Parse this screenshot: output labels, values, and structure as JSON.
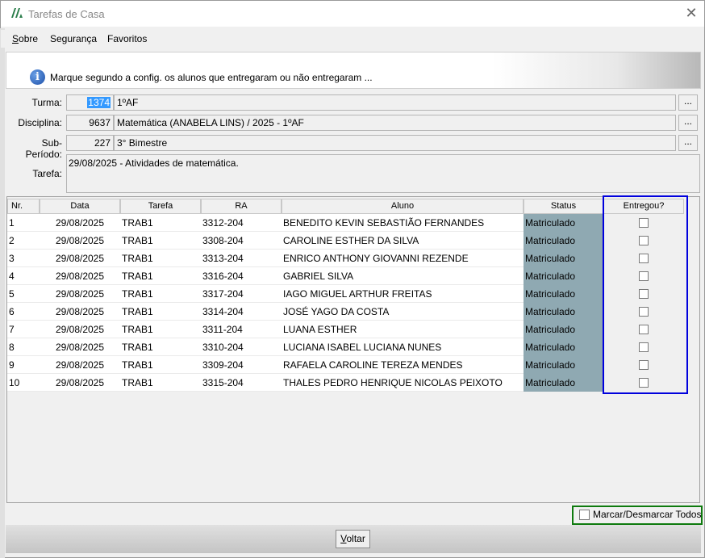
{
  "window": {
    "title": "Tarefas de Casa",
    "close_icon": "close-icon"
  },
  "menu": {
    "items": [
      "Sobre",
      "Segurança",
      "Favoritos"
    ]
  },
  "banner": {
    "icon": "info-icon",
    "text": "Marque segundo a config. os alunos que entregaram ou não entregaram ..."
  },
  "form": {
    "turma": {
      "label": "Turma:",
      "code": "1374",
      "value": "1ºAF"
    },
    "disciplina": {
      "label": "Disciplina:",
      "code": "9637",
      "value": "Matemática  (ANABELA LINS) / 2025 - 1ºAF"
    },
    "subperiodo": {
      "label": "Sub-Período:",
      "code": "227",
      "value": "3° Bimestre"
    },
    "tarefa": {
      "label": "Tarefa:",
      "value": "29/08/2025 - Atividades de matemática."
    },
    "lookup_label": "..."
  },
  "grid": {
    "columns": [
      "Nr.",
      "Data",
      "Tarefa",
      "RA",
      "Aluno",
      "Status",
      "Entregou?"
    ],
    "rows": [
      {
        "nr": "1",
        "data": "29/08/2025",
        "tarefa": "TRAB1",
        "ra": "3312-204",
        "aluno": "BENEDITO KEVIN SEBASTIÃO FERNANDES",
        "status": "Matriculado",
        "entregou": false
      },
      {
        "nr": "2",
        "data": "29/08/2025",
        "tarefa": "TRAB1",
        "ra": "3308-204",
        "aluno": "CAROLINE ESTHER DA SILVA",
        "status": "Matriculado",
        "entregou": false
      },
      {
        "nr": "3",
        "data": "29/08/2025",
        "tarefa": "TRAB1",
        "ra": "3313-204",
        "aluno": "ENRICO ANTHONY GIOVANNI REZENDE",
        "status": "Matriculado",
        "entregou": false
      },
      {
        "nr": "4",
        "data": "29/08/2025",
        "tarefa": "TRAB1",
        "ra": "3316-204",
        "aluno": "GABRIEL SILVA",
        "status": "Matriculado",
        "entregou": false
      },
      {
        "nr": "5",
        "data": "29/08/2025",
        "tarefa": "TRAB1",
        "ra": "3317-204",
        "aluno": "IAGO MIGUEL ARTHUR FREITAS",
        "status": "Matriculado",
        "entregou": false
      },
      {
        "nr": "6",
        "data": "29/08/2025",
        "tarefa": "TRAB1",
        "ra": "3314-204",
        "aluno": "JOSÉ YAGO DA COSTA",
        "status": "Matriculado",
        "entregou": false
      },
      {
        "nr": "7",
        "data": "29/08/2025",
        "tarefa": "TRAB1",
        "ra": "3311-204",
        "aluno": "LUANA ESTHER",
        "status": "Matriculado",
        "entregou": false
      },
      {
        "nr": "8",
        "data": "29/08/2025",
        "tarefa": "TRAB1",
        "ra": "3310-204",
        "aluno": "LUCIANA ISABEL LUCIANA NUNES",
        "status": "Matriculado",
        "entregou": false
      },
      {
        "nr": "9",
        "data": "29/08/2025",
        "tarefa": "TRAB1",
        "ra": "3309-204",
        "aluno": "RAFAELA CAROLINE TEREZA MENDES",
        "status": "Matriculado",
        "entregou": false
      },
      {
        "nr": "10",
        "data": "29/08/2025",
        "tarefa": "TRAB1",
        "ra": "3315-204",
        "aluno": "THALES PEDRO HENRIQUE NICOLAS PEIXOTO",
        "status": "Matriculado",
        "entregou": false
      }
    ]
  },
  "footer": {
    "toggle_all_label": "Marcar/Desmarcar Todos",
    "back_label": "Voltar"
  },
  "colors": {
    "status_bg": "#8fa9b2",
    "highlight_blue": "#0000dd",
    "highlight_green": "#0e7a0e",
    "selection": "#3399ff"
  }
}
